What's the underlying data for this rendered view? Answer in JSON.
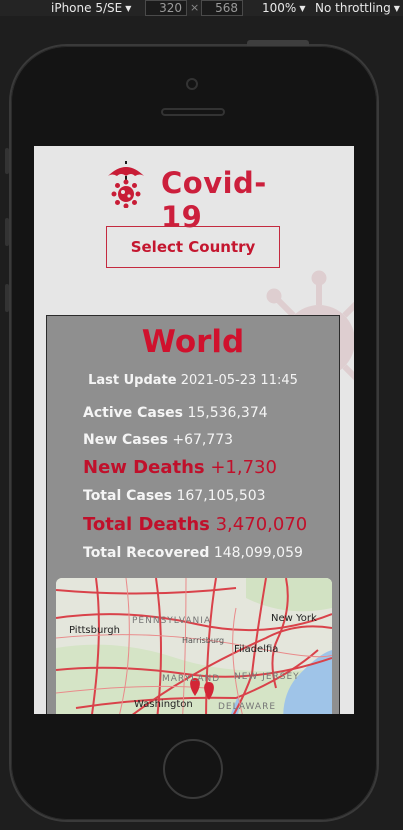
{
  "devtools": {
    "device": "iPhone 5/SE",
    "width": "320",
    "height": "568",
    "zoom": "100%",
    "throttling": "No throttling"
  },
  "app": {
    "title": "Covid-19",
    "select_country_label": "Select Country"
  },
  "card": {
    "region": "World",
    "last_update_label": "Last Update",
    "last_update_value": "2021-05-23 11:45",
    "stats": {
      "active_cases_label": "Active Cases",
      "active_cases_value": "15,536,374",
      "new_cases_label": "New Cases",
      "new_cases_value": "+67,773",
      "new_deaths_label": "New Deaths",
      "new_deaths_value": "+1,730",
      "total_cases_label": "Total Cases",
      "total_cases_value": "167,105,503",
      "total_deaths_label": "Total Deaths",
      "total_deaths_value": "3,470,070",
      "total_recovered_label": "Total Recovered",
      "total_recovered_value": "148,099,059"
    }
  },
  "map": {
    "labels": {
      "pittsburgh": "Pittsburgh",
      "pennsylvania": "PENNSYLVANIA",
      "harrisburg": "Harrisburg",
      "new_york": "New York",
      "filadelfia": "Filadelfia",
      "maryland": "MARYLAND",
      "new_jersey": "NEW JERSEY",
      "washington": "Washington",
      "delaware": "DELAWARE"
    }
  },
  "colors": {
    "accent": "#cc1f3c",
    "card_bg": "#8f8f8f",
    "screen_bg": "#e6e6e6"
  }
}
